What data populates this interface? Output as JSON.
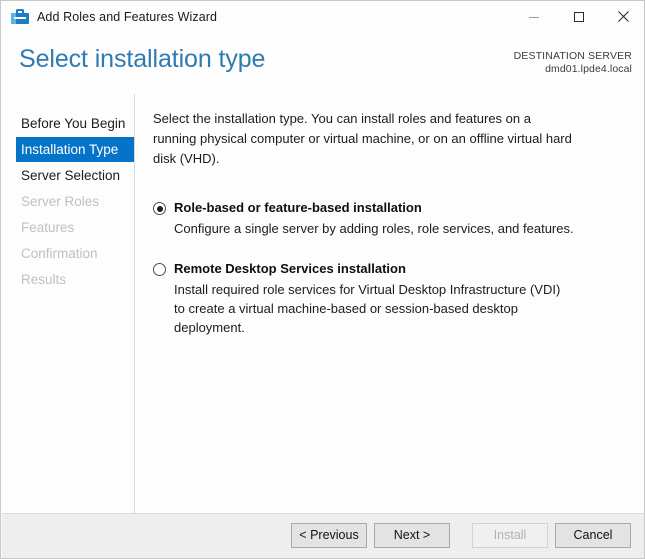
{
  "window": {
    "title": "Add Roles and Features Wizard",
    "icon": "server-roles-icon",
    "controls": {
      "minimize": "minimize-icon",
      "maximize": "maximize-icon",
      "close": "close-icon"
    }
  },
  "header": {
    "page_title": "Select installation type",
    "destination_label": "DESTINATION SERVER",
    "destination_server": "dmd01.lpde4.local",
    "accent_color": "#2f7ab0"
  },
  "sidebar": {
    "selected_index": 1,
    "selected_color": "#0473c8",
    "items": [
      {
        "label": "Before You Begin",
        "state": "enabled"
      },
      {
        "label": "Installation Type",
        "state": "selected"
      },
      {
        "label": "Server Selection",
        "state": "enabled"
      },
      {
        "label": "Server Roles",
        "state": "disabled"
      },
      {
        "label": "Features",
        "state": "disabled"
      },
      {
        "label": "Confirmation",
        "state": "disabled"
      },
      {
        "label": "Results",
        "state": "disabled"
      }
    ]
  },
  "main": {
    "intro": "Select the installation type. You can install roles and features on a running physical computer or virtual  machine, or on an offline virtual hard disk (VHD).",
    "options": [
      {
        "title": "Role-based or feature-based installation",
        "description": "Configure a single server by adding roles, role services, and features.",
        "checked": true
      },
      {
        "title": "Remote Desktop Services installation",
        "description": "Install required role services for Virtual Desktop Infrastructure (VDI) to create a virtual machine-based  or session-based desktop deployment.",
        "checked": false
      }
    ]
  },
  "footer": {
    "buttons": [
      {
        "label": "< Previous",
        "enabled": true
      },
      {
        "label": "Next >",
        "enabled": true
      },
      {
        "label": "Install",
        "enabled": false
      },
      {
        "label": "Cancel",
        "enabled": true
      }
    ]
  }
}
